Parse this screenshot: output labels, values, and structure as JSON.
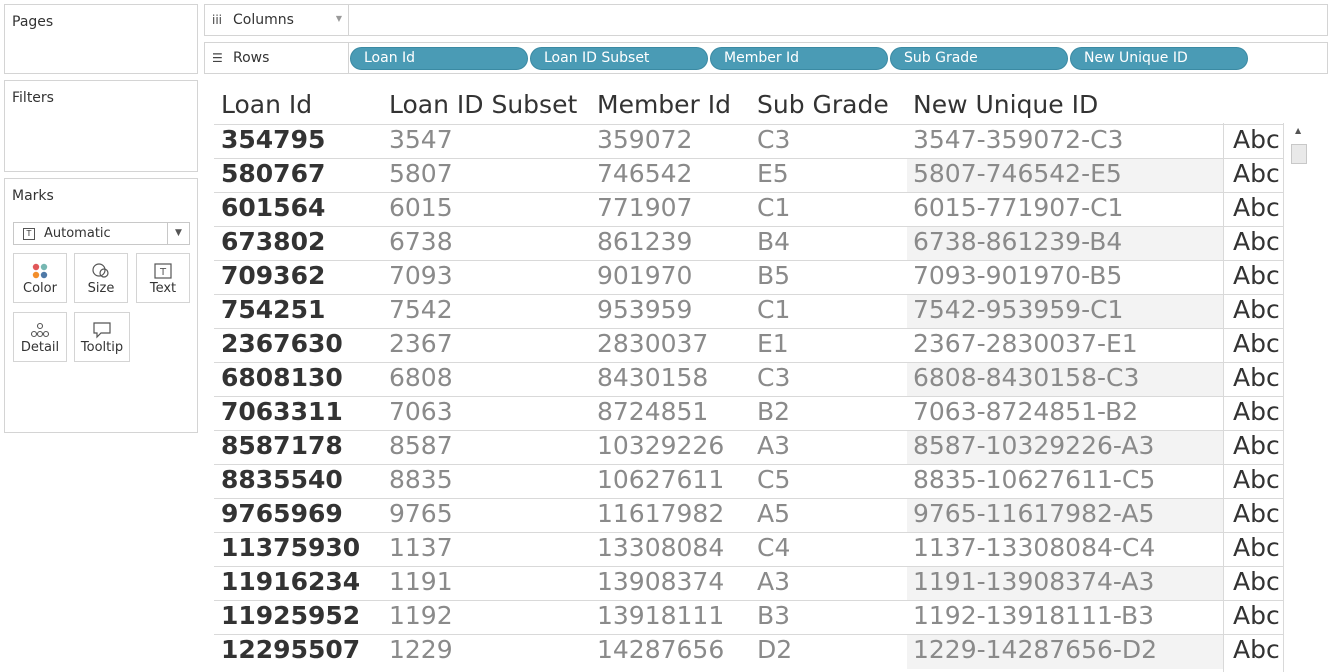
{
  "panels": {
    "pages_title": "Pages",
    "filters_title": "Filters",
    "marks_title": "Marks",
    "mark_type": "Automatic",
    "mark_buttons": {
      "color": "Color",
      "size": "Size",
      "text": "Text",
      "detail": "Detail",
      "tooltip": "Tooltip"
    }
  },
  "shelves": {
    "columns_label": "Columns",
    "rows_label": "Rows",
    "row_pills": [
      "Loan Id",
      "Loan ID Subset",
      "Member Id",
      "Sub Grade",
      "New Unique ID"
    ]
  },
  "table": {
    "headers": [
      "Loan Id",
      "Loan ID Subset",
      "Member Id",
      "Sub Grade",
      "New Unique ID"
    ],
    "abc_text": "Abc",
    "rows": [
      [
        "354795",
        "3547",
        "359072",
        "C3",
        "3547-359072-C3"
      ],
      [
        "580767",
        "5807",
        "746542",
        "E5",
        "5807-746542-E5"
      ],
      [
        "601564",
        "6015",
        "771907",
        "C1",
        "6015-771907-C1"
      ],
      [
        "673802",
        "6738",
        "861239",
        "B4",
        "6738-861239-B4"
      ],
      [
        "709362",
        "7093",
        "901970",
        "B5",
        "7093-901970-B5"
      ],
      [
        "754251",
        "7542",
        "953959",
        "C1",
        "7542-953959-C1"
      ],
      [
        "2367630",
        "2367",
        "2830037",
        "E1",
        "2367-2830037-E1"
      ],
      [
        "6808130",
        "6808",
        "8430158",
        "C3",
        "6808-8430158-C3"
      ],
      [
        "7063311",
        "7063",
        "8724851",
        "B2",
        "7063-8724851-B2"
      ],
      [
        "8587178",
        "8587",
        "10329226",
        "A3",
        "8587-10329226-A3"
      ],
      [
        "8835540",
        "8835",
        "10627611",
        "C5",
        "8835-10627611-C5"
      ],
      [
        "9765969",
        "9765",
        "11617982",
        "A5",
        "9765-11617982-A5"
      ],
      [
        "11375930",
        "1137",
        "13308084",
        "C4",
        "1137-13308084-C4"
      ],
      [
        "11916234",
        "1191",
        "13908374",
        "A3",
        "1191-13908374-A3"
      ],
      [
        "11925952",
        "1192",
        "13918111",
        "B3",
        "1192-13918111-B3"
      ],
      [
        "12295507",
        "1229",
        "14287656",
        "D2",
        "1229-14287656-D2"
      ]
    ]
  },
  "colors": {
    "pill": "#4a9bb5",
    "band": "#f3f3f3"
  }
}
